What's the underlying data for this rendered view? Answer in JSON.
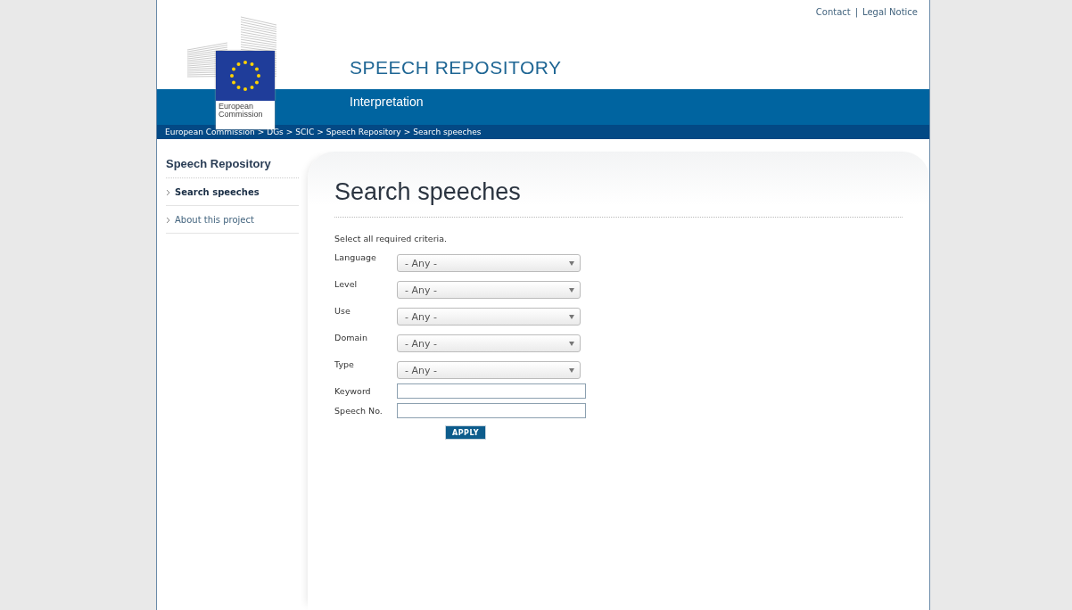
{
  "top_links": [
    "Contact",
    "Legal Notice"
  ],
  "top_links_separator": "|",
  "logo": {
    "caption": "European Commission"
  },
  "site_title": "SPEECH REPOSITORY",
  "site_subtitle": "Interpretation",
  "breadcrumb": [
    "European Commission",
    "DGs",
    "SCIC",
    "Speech Repository",
    "Search speeches"
  ],
  "breadcrumb_separator": ">",
  "sidebar": {
    "title": "Speech Repository",
    "items": [
      {
        "label": "Search speeches",
        "selected": true
      },
      {
        "label": "About this project",
        "selected": false
      }
    ]
  },
  "page_title": "Search speeches",
  "instructions": "Select all required criteria.",
  "fields": [
    {
      "label": "Language",
      "kind": "select",
      "value": "- Any -"
    },
    {
      "label": "Level",
      "kind": "select",
      "value": "- Any -"
    },
    {
      "label": "Use",
      "kind": "select",
      "value": "- Any -"
    },
    {
      "label": "Domain",
      "kind": "select",
      "value": "- Any -"
    },
    {
      "label": "Type",
      "kind": "select",
      "value": "- Any -"
    },
    {
      "label": "Keyword",
      "kind": "text"
    },
    {
      "label": "Speech No.",
      "kind": "text"
    }
  ],
  "apply_button": "APPLY"
}
